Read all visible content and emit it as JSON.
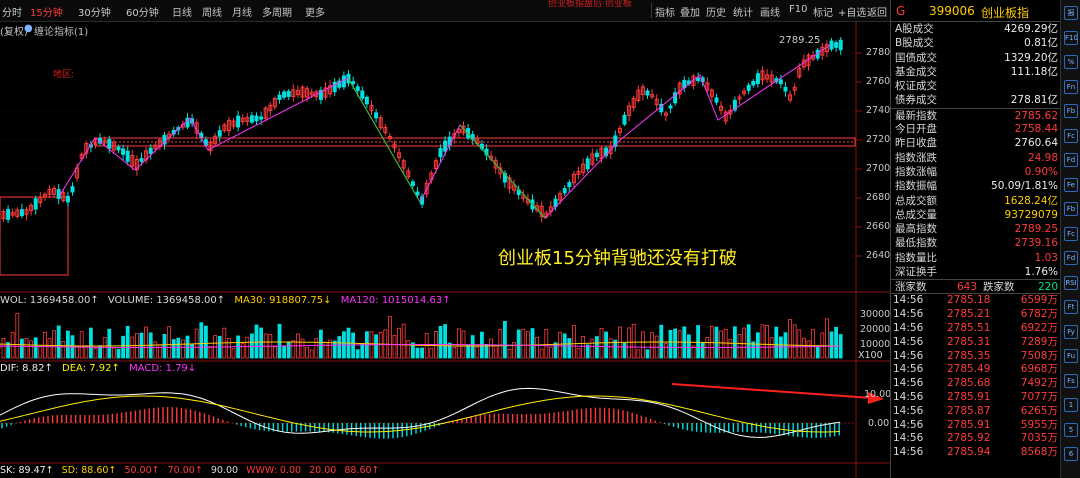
{
  "toolbar": {
    "periods": [
      "分时",
      "15分钟",
      "30分钟",
      "60分钟",
      "日线",
      "周线",
      "月线",
      "多周期",
      "更多"
    ],
    "selected_period": "15分钟",
    "alert_text": "创业板指盘后·创业板",
    "buttons": [
      "指标",
      "叠加",
      "历史",
      "统计",
      "画线",
      "F10",
      "标记",
      "+自选",
      "返回"
    ]
  },
  "subbar": {
    "left": "(复权)",
    "indicator": "缠论指标(1)"
  },
  "chart_labels": {
    "area_label": "地区:",
    "high_label": "2789.25",
    "annotation": "创业板15分钟背驰还没有打破"
  },
  "y_axis": [
    "2780",
    "2760",
    "2740",
    "2720",
    "2700",
    "2680",
    "2660",
    "2640"
  ],
  "volume": {
    "wol": "WOL: 1369458.00↑",
    "volume": "VOLUME: 1369458.00↑",
    "ma30": "MA30: 918807.75↓",
    "ma120": "MA120: 1015014.63↑",
    "axis": [
      "30000",
      "20000",
      "10000",
      "X100"
    ]
  },
  "macd": {
    "dif": "DIF: 8.82↑",
    "dea": "DEA: 7.92↑",
    "macd": "MACD: 1.79↓",
    "axis": [
      "10.00",
      "0.00"
    ]
  },
  "kd": {
    "sk": "SK: 89.47↑",
    "sd": "SD: 88.60↑",
    "l50": "50.00↑",
    "l70": "70.00↑",
    "l90": "90.00",
    "www": "WWW: 0.00",
    "l20": "20.00",
    "l88": "88.60↑"
  },
  "colors": {
    "up": "#ff3b3b",
    "down": "#00e0e0",
    "zhongshu": "#ff3b3b",
    "bi": "#ff33ff",
    "ma": "#ffcc00",
    "dif": "#ffffff",
    "dea": "#ffee00"
  },
  "quote": {
    "code": "399006",
    "name": "创业板指",
    "g": "G",
    "rows": [
      {
        "label": "A股成交",
        "value": "4269.29亿",
        "cls": "white"
      },
      {
        "label": "B股成交",
        "value": "0.81亿",
        "cls": "white"
      },
      {
        "label": "国债成交",
        "value": "1329.20亿",
        "cls": "white"
      },
      {
        "label": "基金成交",
        "value": "111.18亿",
        "cls": "white"
      },
      {
        "label": "权证成交",
        "value": "",
        "cls": "white"
      },
      {
        "label": "债券成交",
        "value": "278.81亿",
        "cls": "white"
      },
      {
        "label": "最新指数",
        "value": "2785.62",
        "cls": "red"
      },
      {
        "label": "今日开盘",
        "value": "2758.44",
        "cls": "red"
      },
      {
        "label": "昨日收盘",
        "value": "2760.64",
        "cls": "white"
      },
      {
        "label": "指数涨跌",
        "value": "24.98",
        "cls": "red"
      },
      {
        "label": "指数涨幅",
        "value": "0.90%",
        "cls": "red"
      },
      {
        "label": "指数振幅",
        "value": "50.09/1.81%",
        "cls": "white"
      },
      {
        "label": "总成交额",
        "value": "1628.24亿",
        "cls": "yellow"
      },
      {
        "label": "总成交量",
        "value": "93729079",
        "cls": "yellow"
      },
      {
        "label": "最高指数",
        "value": "2789.25",
        "cls": "red"
      },
      {
        "label": "最低指数",
        "value": "2739.16",
        "cls": "red"
      },
      {
        "label": "指数量比",
        "value": "1.03",
        "cls": "red"
      },
      {
        "label": "深证换手",
        "value": "1.76%",
        "cls": "white"
      }
    ],
    "up_label": "涨家数",
    "up_count": "643",
    "down_label": "跌家数",
    "down_count": "220",
    "ticks": [
      {
        "t": "14:56",
        "p": "2785.18",
        "v": "6599万"
      },
      {
        "t": "14:56",
        "p": "2785.21",
        "v": "6782万"
      },
      {
        "t": "14:56",
        "p": "2785.51",
        "v": "6922万"
      },
      {
        "t": "14:56",
        "p": "2785.31",
        "v": "7289万"
      },
      {
        "t": "14:56",
        "p": "2785.35",
        "v": "7508万"
      },
      {
        "t": "14:56",
        "p": "2785.49",
        "v": "6968万"
      },
      {
        "t": "14:56",
        "p": "2785.68",
        "v": "7492万"
      },
      {
        "t": "14:56",
        "p": "2785.91",
        "v": "7077万"
      },
      {
        "t": "14:56",
        "p": "2785.87",
        "v": "6265万"
      },
      {
        "t": "14:56",
        "p": "2785.91",
        "v": "5955万"
      },
      {
        "t": "14:56",
        "p": "2785.92",
        "v": "7035万"
      },
      {
        "t": "14:56",
        "p": "2785.94",
        "v": "8568万"
      }
    ]
  },
  "side_icons": [
    "报",
    "F10",
    "%",
    "Fn",
    "Fb",
    "Fc",
    "Fd",
    "Fe",
    "Fb",
    "Fc",
    "Fd",
    "RSI",
    "Ft",
    "Fy",
    "Fu",
    "Fs",
    "1",
    "5",
    "6"
  ]
}
